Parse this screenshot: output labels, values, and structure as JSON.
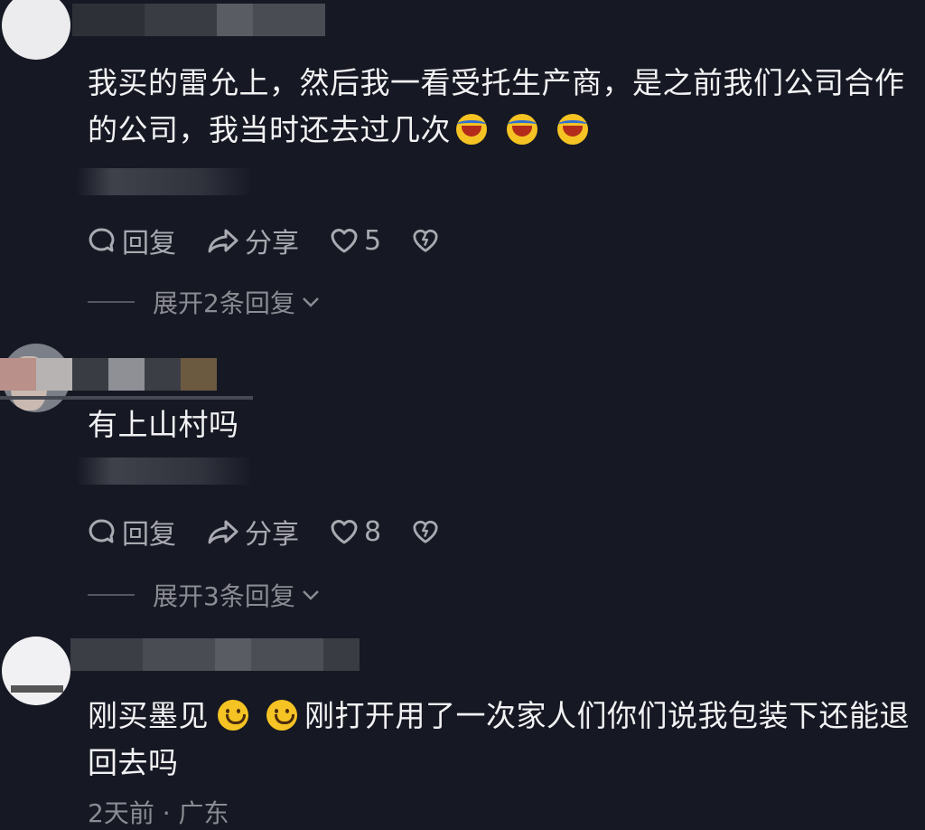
{
  "comments": [
    {
      "text_line1": "我买的雷允上，然后我一看受托生产商，是之前我们公司合作",
      "text_line2": "的公司，我当时还去过几次",
      "emojis": [
        "laugh-cry-emoji",
        "laugh-cry-emoji",
        "laugh-cry-emoji"
      ],
      "reply_label": "回复",
      "share_label": "分享",
      "like_count": "5",
      "expand_label": "展开2条回复"
    },
    {
      "text_line1": "有上山村吗",
      "reply_label": "回复",
      "share_label": "分享",
      "like_count": "8",
      "expand_label": "展开3条回复"
    },
    {
      "text_line1_a": "刚买墨见",
      "text_line1_b": "刚打开用了一次家人们你们说我包装下还能退",
      "text_line2": "回去吗",
      "emojis": [
        "smile-emoji",
        "smile-emoji"
      ],
      "meta": "2天前 · 广东"
    }
  ],
  "colors": {
    "background": "#161823",
    "text": "#f2f2f4",
    "secondary": "#a9aab1",
    "muted": "#8b8c93"
  }
}
